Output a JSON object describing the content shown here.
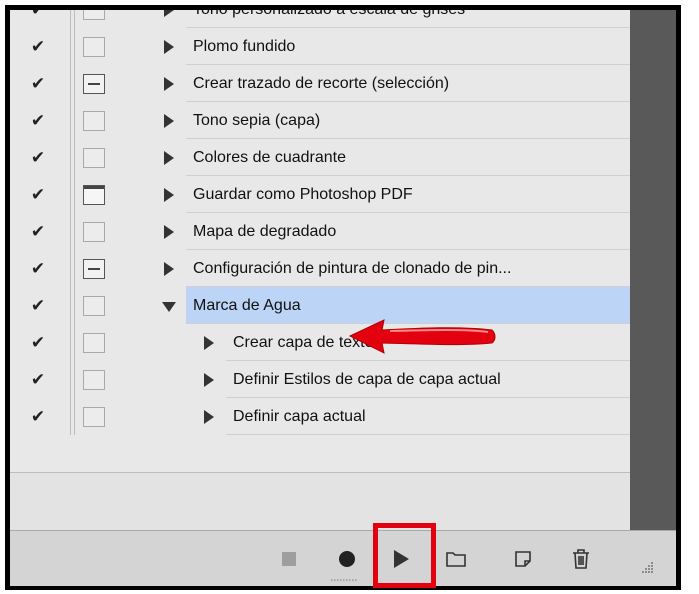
{
  "actions": [
    {
      "label": "Tono personalizado a escala de grises",
      "checked": true,
      "dialog": "none",
      "expanded": false,
      "level": 0,
      "partial": true
    },
    {
      "label": "Plomo fundido",
      "checked": true,
      "dialog": "none",
      "expanded": false,
      "level": 0
    },
    {
      "label": "Crear trazado de recorte (selección)",
      "checked": true,
      "dialog": "on",
      "expanded": false,
      "level": 0
    },
    {
      "label": "Tono sepia (capa)",
      "checked": true,
      "dialog": "none",
      "expanded": false,
      "level": 0
    },
    {
      "label": "Colores de cuadrante",
      "checked": true,
      "dialog": "none",
      "expanded": false,
      "level": 0
    },
    {
      "label": "Guardar como Photoshop PDF",
      "checked": true,
      "dialog": "full",
      "expanded": false,
      "level": 0
    },
    {
      "label": "Mapa de degradado",
      "checked": true,
      "dialog": "none",
      "expanded": false,
      "level": 0
    },
    {
      "label": "Configuración de pintura de clonado de pin...",
      "checked": true,
      "dialog": "on",
      "expanded": false,
      "level": 0
    },
    {
      "label": "Marca de Agua",
      "checked": true,
      "dialog": "none",
      "expanded": true,
      "level": 0,
      "selected": true
    },
    {
      "label": "Crear capa de texto",
      "checked": true,
      "dialog": "none",
      "expanded": false,
      "level": 1
    },
    {
      "label": "Definir Estilos de capa de capa actual",
      "checked": true,
      "dialog": "none",
      "expanded": false,
      "level": 1
    },
    {
      "label": "Definir capa actual",
      "checked": true,
      "dialog": "none",
      "expanded": false,
      "level": 1
    }
  ],
  "check_glyph": "✔",
  "toolbar": {
    "buttons": [
      "stop-icon",
      "record-icon",
      "play-icon",
      "new-set-icon",
      "new-action-icon",
      "delete-icon"
    ]
  },
  "colors": {
    "selection": "#bcd4f6",
    "annotation_red": "#e3000f",
    "panel_bg": "#e8e8e8"
  }
}
